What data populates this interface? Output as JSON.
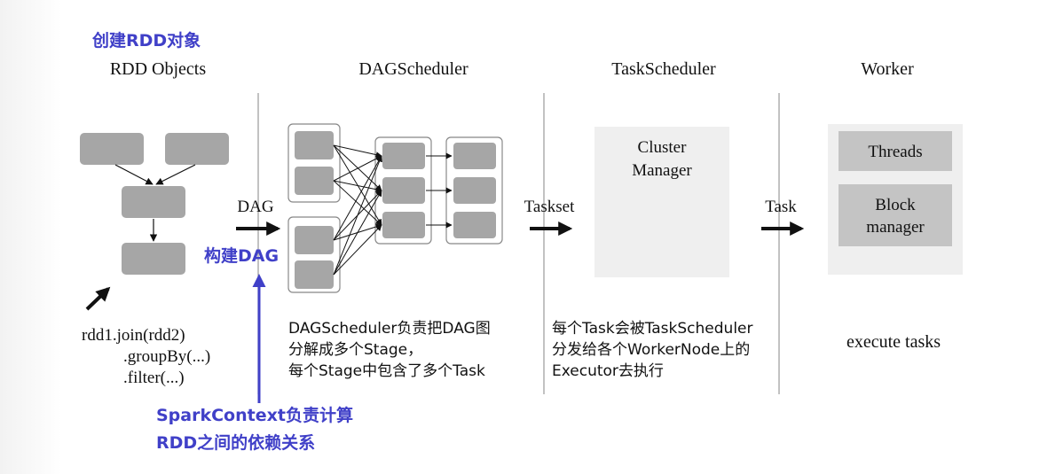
{
  "annotations": {
    "create_rdd": "创建RDD对象",
    "build_dag": "构建DAG",
    "sparkcontext_line1": "SparkContext负责计算",
    "sparkcontext_line2": "RDD之间的依赖关系"
  },
  "columns": {
    "rdd_objects": "RDD Objects",
    "dag_scheduler": "DAGScheduler",
    "task_scheduler": "TaskScheduler",
    "worker": "Worker"
  },
  "arrows": {
    "dag": "DAG",
    "taskset": "Taskset",
    "task": "Task"
  },
  "code": {
    "line1": "rdd1.join(rdd2)",
    "line2": ".groupBy(...)",
    "line3": ".filter(...)"
  },
  "dag_description": {
    "line1": "DAGScheduler负责把DAG图",
    "line2": "分解成多个Stage，",
    "line3": "每个Stage中包含了多个Task"
  },
  "task_description": {
    "line1": "每个Task会被TaskScheduler",
    "line2": "分发给各个WorkerNode上的",
    "line3": "Executor去执行"
  },
  "cluster_manager": {
    "line1": "Cluster",
    "line2": "Manager"
  },
  "worker_boxes": {
    "threads": "Threads",
    "block_line1": "Block",
    "block_line2": "manager"
  },
  "worker_caption": "execute tasks",
  "colors": {
    "annotation_blue": "#4040c8",
    "node_gray": "#a6a6a6",
    "panel_gray": "#efefef"
  }
}
